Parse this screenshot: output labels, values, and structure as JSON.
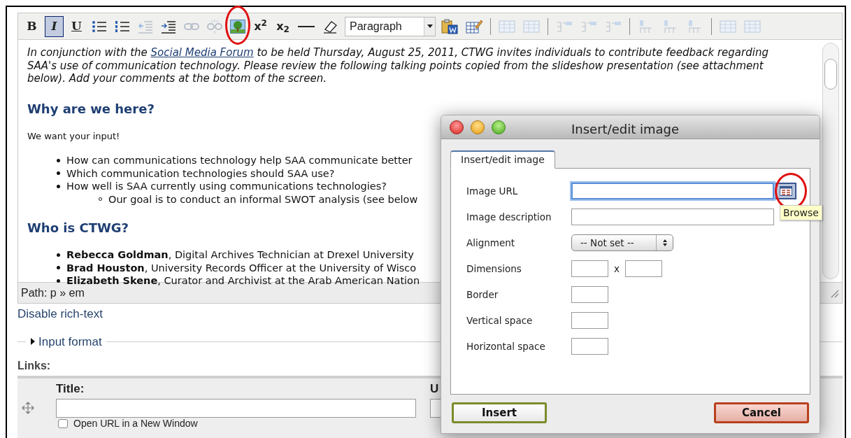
{
  "toolbar": [
    {
      "kind": "bold",
      "label": "B",
      "active": false
    },
    {
      "kind": "italic",
      "label": "I",
      "active": true
    },
    {
      "kind": "underline",
      "label": "U",
      "active": false
    },
    {
      "kind": "bullet-list",
      "disabled": false
    },
    {
      "kind": "numbered-list",
      "disabled": false
    },
    {
      "kind": "outdent",
      "disabled": true
    },
    {
      "kind": "indent",
      "disabled": false
    },
    {
      "kind": "link",
      "disabled": true
    },
    {
      "kind": "unlink",
      "disabled": true
    },
    {
      "kind": "image"
    },
    {
      "kind": "superscript",
      "label": "x$^{2}$",
      "active": false
    },
    {
      "kind": "subscript",
      "label": "x$_{2}$",
      "active": false
    },
    {
      "kind": "rule",
      "disabled": false
    },
    {
      "kind": "eraser",
      "disabled": false
    },
    {
      "kind": "format-select",
      "value": "Paragraph"
    },
    {
      "kind": "paste-word"
    },
    {
      "kind": "edit-table"
    },
    {
      "kind": "separator"
    },
    {
      "kind": "table",
      "disabled": true
    },
    {
      "kind": "table",
      "disabled": true
    },
    {
      "kind": "separator"
    },
    {
      "kind": "row",
      "disabled": true
    },
    {
      "kind": "row",
      "disabled": true
    },
    {
      "kind": "row",
      "disabled": true
    },
    {
      "kind": "separator"
    },
    {
      "kind": "column",
      "disabled": true
    },
    {
      "kind": "column",
      "disabled": true
    },
    {
      "kind": "column",
      "disabled": true
    },
    {
      "kind": "separator"
    },
    {
      "kind": "table",
      "disabled": true
    },
    {
      "kind": "table",
      "disabled": true
    }
  ],
  "content": {
    "intro": {
      "before": "In conjunction with the ",
      "link": "Social Media Forum",
      "after": " to be held Thursday, August 25, 2011, CTWG invites individuals to contribute feedback regarding SAA's use of communication technology. Please review the following talking points copied from the slideshow presentation (see attachment below). Add your comments at the bottom of the screen."
    },
    "blocks": [
      {
        "kind": "heading",
        "text": "Why are we here?"
      },
      {
        "kind": "paragraph",
        "text": "We want your input!"
      },
      {
        "kind": "list",
        "items": [
          {
            "text": "How can communications technology help SAA communicate better"
          },
          {
            "text": "Which communication technologies should SAA use?"
          },
          {
            "text": "How well is SAA currently using communications technologies?",
            "children": [
              {
                "text": "Our goal is to conduct an informal SWOT analysis (see below"
              }
            ]
          }
        ]
      },
      {
        "kind": "heading",
        "text": "Who is CTWG?"
      },
      {
        "kind": "list",
        "items": [
          {
            "text": "**Rebecca Goldman**, Digital Archives Technician at Drexel University"
          },
          {
            "text": "**Brad Houston**, University Records Officer at the University of Wisco"
          },
          {
            "text": "**Elizabeth Skene**, Curator and Archivist at the Arab American Nation"
          }
        ]
      }
    ]
  },
  "path": "Path: p » em",
  "disable_link": "Disable rich-text",
  "input_format": {
    "label": "Input format",
    "expanded": false
  },
  "links": {
    "heading": "Links:",
    "columns": [
      "Title:",
      "U"
    ],
    "checkbox": {
      "label": "Open URL in a New Window",
      "checked": false
    }
  },
  "dialog": {
    "title": "Insert/edit image",
    "tabs": [
      {
        "label": "Insert/edit image",
        "selected": true
      }
    ],
    "fields": [
      {
        "kind": "url",
        "label": "Image URL",
        "focused": true,
        "tooltip": "Browse"
      },
      {
        "kind": "text",
        "label": "Image description",
        "focused": false
      },
      {
        "kind": "select",
        "label": "Alignment",
        "value": "-- Not set --"
      },
      {
        "kind": "dimensions",
        "label": "Dimensions",
        "separator": "x"
      },
      {
        "kind": "small",
        "label": "Border"
      },
      {
        "kind": "small",
        "label": "Vertical space"
      },
      {
        "kind": "small",
        "label": "Horizontal space"
      }
    ],
    "buttons": [
      {
        "label": "Insert",
        "kind": "insert"
      },
      {
        "label": "Cancel",
        "kind": "cancel"
      }
    ]
  }
}
